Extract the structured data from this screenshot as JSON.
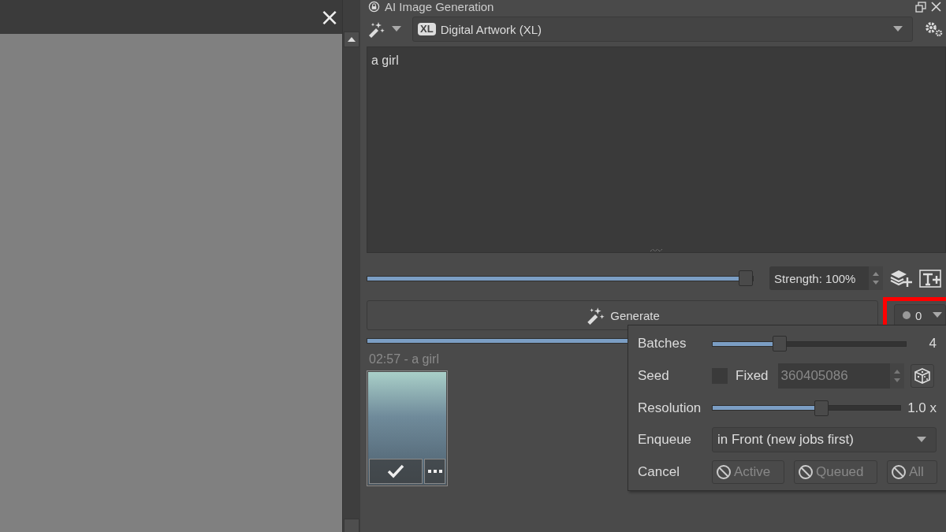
{
  "canvas": {
    "close_label": "×"
  },
  "docker": {
    "title": "AI Image Generation"
  },
  "style_select": {
    "badge": "XL",
    "value": "Digital Artwork (XL)"
  },
  "prompt": {
    "value": "a girl"
  },
  "strength": {
    "level": 0.98,
    "value": "Strength: 100%"
  },
  "generate": {
    "label": "Generate",
    "queue_count": "0",
    "highlighted": true,
    "progress": {
      "level": 1
    }
  },
  "history": {
    "heading": "02:57 - a girl"
  },
  "queue_popup": {
    "rows": [
      {
        "kind": "slider",
        "label": "Batches",
        "level": 0.35,
        "reading": "4"
      },
      {
        "kind": "seed",
        "label": "Seed",
        "checked": false,
        "check_label": "Fixed",
        "value": "360405086"
      },
      {
        "kind": "slider",
        "label": "Resolution",
        "level": 0.58,
        "reading": "1.0 x"
      },
      {
        "kind": "select",
        "label": "Enqueue",
        "value": "in Front (new jobs first)"
      },
      {
        "kind": "buttons",
        "label": "Cancel",
        "buttons": [
          {
            "label": "Active",
            "disabled": true
          },
          {
            "label": "Queued",
            "disabled": true
          },
          {
            "label": "All",
            "disabled": true
          }
        ]
      }
    ]
  }
}
